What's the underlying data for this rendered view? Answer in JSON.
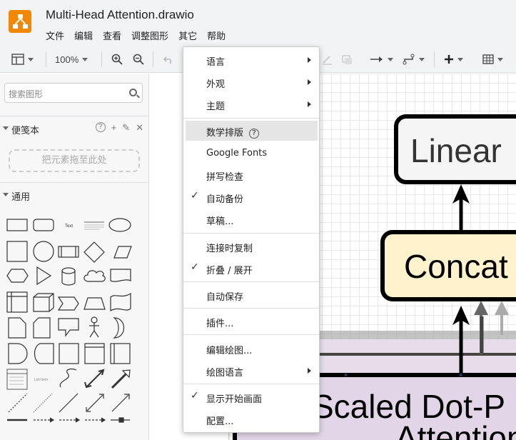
{
  "window": {
    "title": "Multi-Head Attention.drawio"
  },
  "menubar": [
    "文件",
    "编辑",
    "查看",
    "调整图形",
    "其它",
    "帮助"
  ],
  "toolbar": {
    "zoom": "100%"
  },
  "sidebar": {
    "search_placeholder": "搜索图形",
    "scratchpad": {
      "title": "便笺本",
      "tools": [
        "?",
        "+",
        "✎",
        "✕"
      ],
      "drop_hint": "把元素拖至此处"
    },
    "general": {
      "title": "通用"
    }
  },
  "menu": {
    "items": [
      {
        "label": "语言",
        "submenu": true
      },
      {
        "label": "外观",
        "submenu": true
      },
      {
        "label": "主题",
        "submenu": true
      },
      {
        "label": "数学排版",
        "highlighted": true,
        "help": true
      },
      {
        "label": "Google Fonts"
      },
      {
        "label": "拼写检查"
      },
      {
        "label": "自动备份",
        "checked": true
      },
      {
        "label": "草稿..."
      },
      {
        "label": "连接时复制"
      },
      {
        "label": "折叠 / 展开",
        "checked": true
      },
      {
        "label": "自动保存"
      },
      {
        "label": "插件..."
      },
      {
        "label": "编辑绘图..."
      },
      {
        "label": "绘图语言",
        "submenu": true
      },
      {
        "label": "显示开始画面",
        "checked": true
      },
      {
        "label": "配置..."
      }
    ]
  },
  "diagram": {
    "linear_label": "Linear",
    "concat_label": "Concat",
    "sdpa_label_line1": "Scaled Dot-P",
    "sdpa_label_line2": "Attention"
  },
  "colors": {
    "logo": "#f08705",
    "concat_fill": "#fff2cc",
    "sdpa_fill": "#e1d5e7",
    "linear_fill": "#f5f5f5"
  }
}
